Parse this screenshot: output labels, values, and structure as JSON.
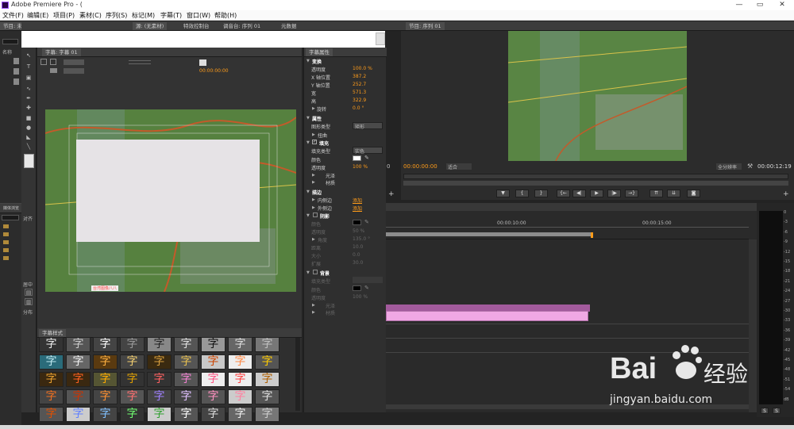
{
  "app": {
    "title": "Adobe Premiere Pro - (",
    "window_controls": [
      "—",
      "▭",
      "✕"
    ]
  },
  "menu": [
    "文件(F)",
    "编辑(E)",
    "项目(P)",
    "素材(C)",
    "序列(S)",
    "标记(M)",
    "字幕(T)",
    "窗口(W)",
    "帮助(H)"
  ],
  "project_panel": {
    "tab": "节目: 未命名",
    "search_icon": "search-icon",
    "col_name": "名称",
    "effects_tab": "媒体浏览",
    "objects_label": "对齐",
    "center_label": "居中",
    "distribute_label": "分布"
  },
  "top_tabs": [
    "源: (无素材)",
    "特效控制台",
    "调音台: 序列 01",
    "元数据"
  ],
  "title_editor": {
    "tab": "字幕: 字幕 01",
    "timecode": "00:00:00:00",
    "safe_label": "台湾图像八八"
  },
  "styles_panel": {
    "tab": "字幕样式",
    "glyph": "字"
  },
  "title_properties": {
    "tab": "字幕属性",
    "transform_header": "变换",
    "transform": [
      {
        "label": "透明度",
        "value": "100.0 %"
      },
      {
        "label": "X 轴位置",
        "value": "387.2"
      },
      {
        "label": "Y 轴位置",
        "value": "252.7"
      },
      {
        "label": "宽",
        "value": "571.3"
      },
      {
        "label": "高",
        "value": "322.9"
      },
      {
        "label": "旋转",
        "value": "0.0 °"
      }
    ],
    "properties_header": "属性",
    "shape_type_label": "图形类型",
    "shape_type_value": "矩形",
    "distort_label": "扭曲",
    "fill_header": "填充",
    "fill_type_label": "填充类型",
    "fill_type_value": "实色",
    "color_label": "颜色",
    "opacity_label": "透明度",
    "opacity_value": "100 %",
    "sheen_label": "光泽",
    "texture_label": "材质",
    "strokes_header": "描边",
    "inner_stroke": "内侧边",
    "outer_stroke": "外侧边",
    "add_label": "添加",
    "shadow_header": "阴影",
    "shadow": [
      {
        "label": "颜色",
        "value": ""
      },
      {
        "label": "透明度",
        "value": "50 %"
      },
      {
        "label": "角度",
        "value": "135.0 °"
      },
      {
        "label": "距离",
        "value": "10.0"
      },
      {
        "label": "大小",
        "value": "0.0"
      },
      {
        "label": "扩展",
        "value": "30.0"
      }
    ],
    "background_header": "背景",
    "bg": [
      {
        "label": "填充类型",
        "value": ""
      },
      {
        "label": "颜色",
        "value": ""
      },
      {
        "label": "透明度",
        "value": "100 %"
      },
      {
        "label": "光泽",
        "value": ""
      },
      {
        "label": "材质",
        "value": ""
      }
    ]
  },
  "program_monitor": {
    "tab": "节目: 序列 01",
    "timecode_left": "00:00:00:00",
    "zoom": "适合",
    "quality": "全分辨率",
    "timecode_right": "00:00:12:19",
    "partial_timecode": "0"
  },
  "timeline": {
    "ruler": [
      "00:00:10:00",
      "00:00:15:00"
    ]
  },
  "audio_meter": {
    "labels": [
      "0",
      "-3",
      "-6",
      "-9",
      "-12",
      "-15",
      "-18",
      "-21",
      "-24",
      "-27",
      "-30",
      "-33",
      "-36",
      "-39",
      "-42",
      "-45",
      "-48",
      "-51",
      "-54",
      "dB"
    ],
    "buttons": [
      "S",
      "S"
    ]
  },
  "watermark": {
    "brand": "Bai",
    "brand2": "经验",
    "url": "jingyan.baidu.com"
  },
  "colors": {
    "accent": "#ff9c1a",
    "title_white_box": "#e6e3e6",
    "clip_pink": "#f0a8e4",
    "clip_purple": "#a25a9c",
    "map_green": "#4e7d3a"
  }
}
